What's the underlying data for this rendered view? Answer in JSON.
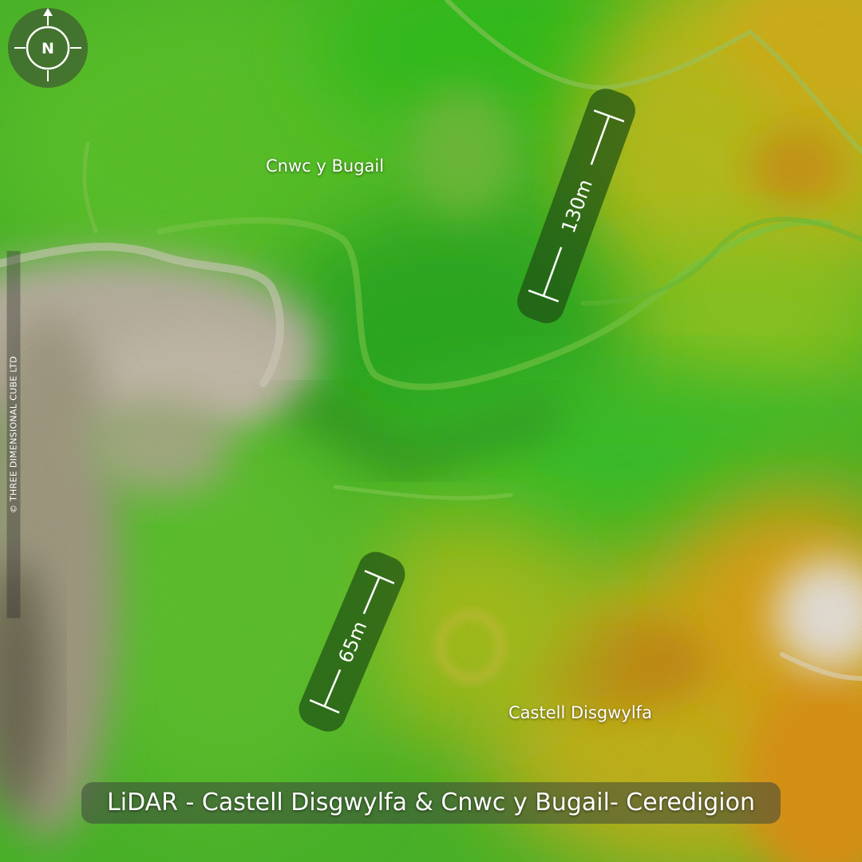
{
  "map": {
    "title": "LiDAR - Castell Disgwylfa & Cnwc y Bugail- Ceredigion",
    "copyright": "© THREE DIMENSIONAL CUBE LTD",
    "compass": {
      "label": "N",
      "icon": "compass-rose-icon"
    },
    "places": [
      {
        "name": "Cnwc y Bugail"
      },
      {
        "name": "Castell Disgwylfa"
      }
    ],
    "scale_bars": [
      {
        "label": "130m"
      },
      {
        "label": "65m"
      }
    ],
    "colors": {
      "low_ground": "#b5b0a0",
      "valley_green": "#3fb52c",
      "hill_green": "#6cd21a",
      "upland_yellow": "#c9c21c",
      "summit_orange": "#d98a10",
      "peak_white": "#eee9e1"
    }
  }
}
